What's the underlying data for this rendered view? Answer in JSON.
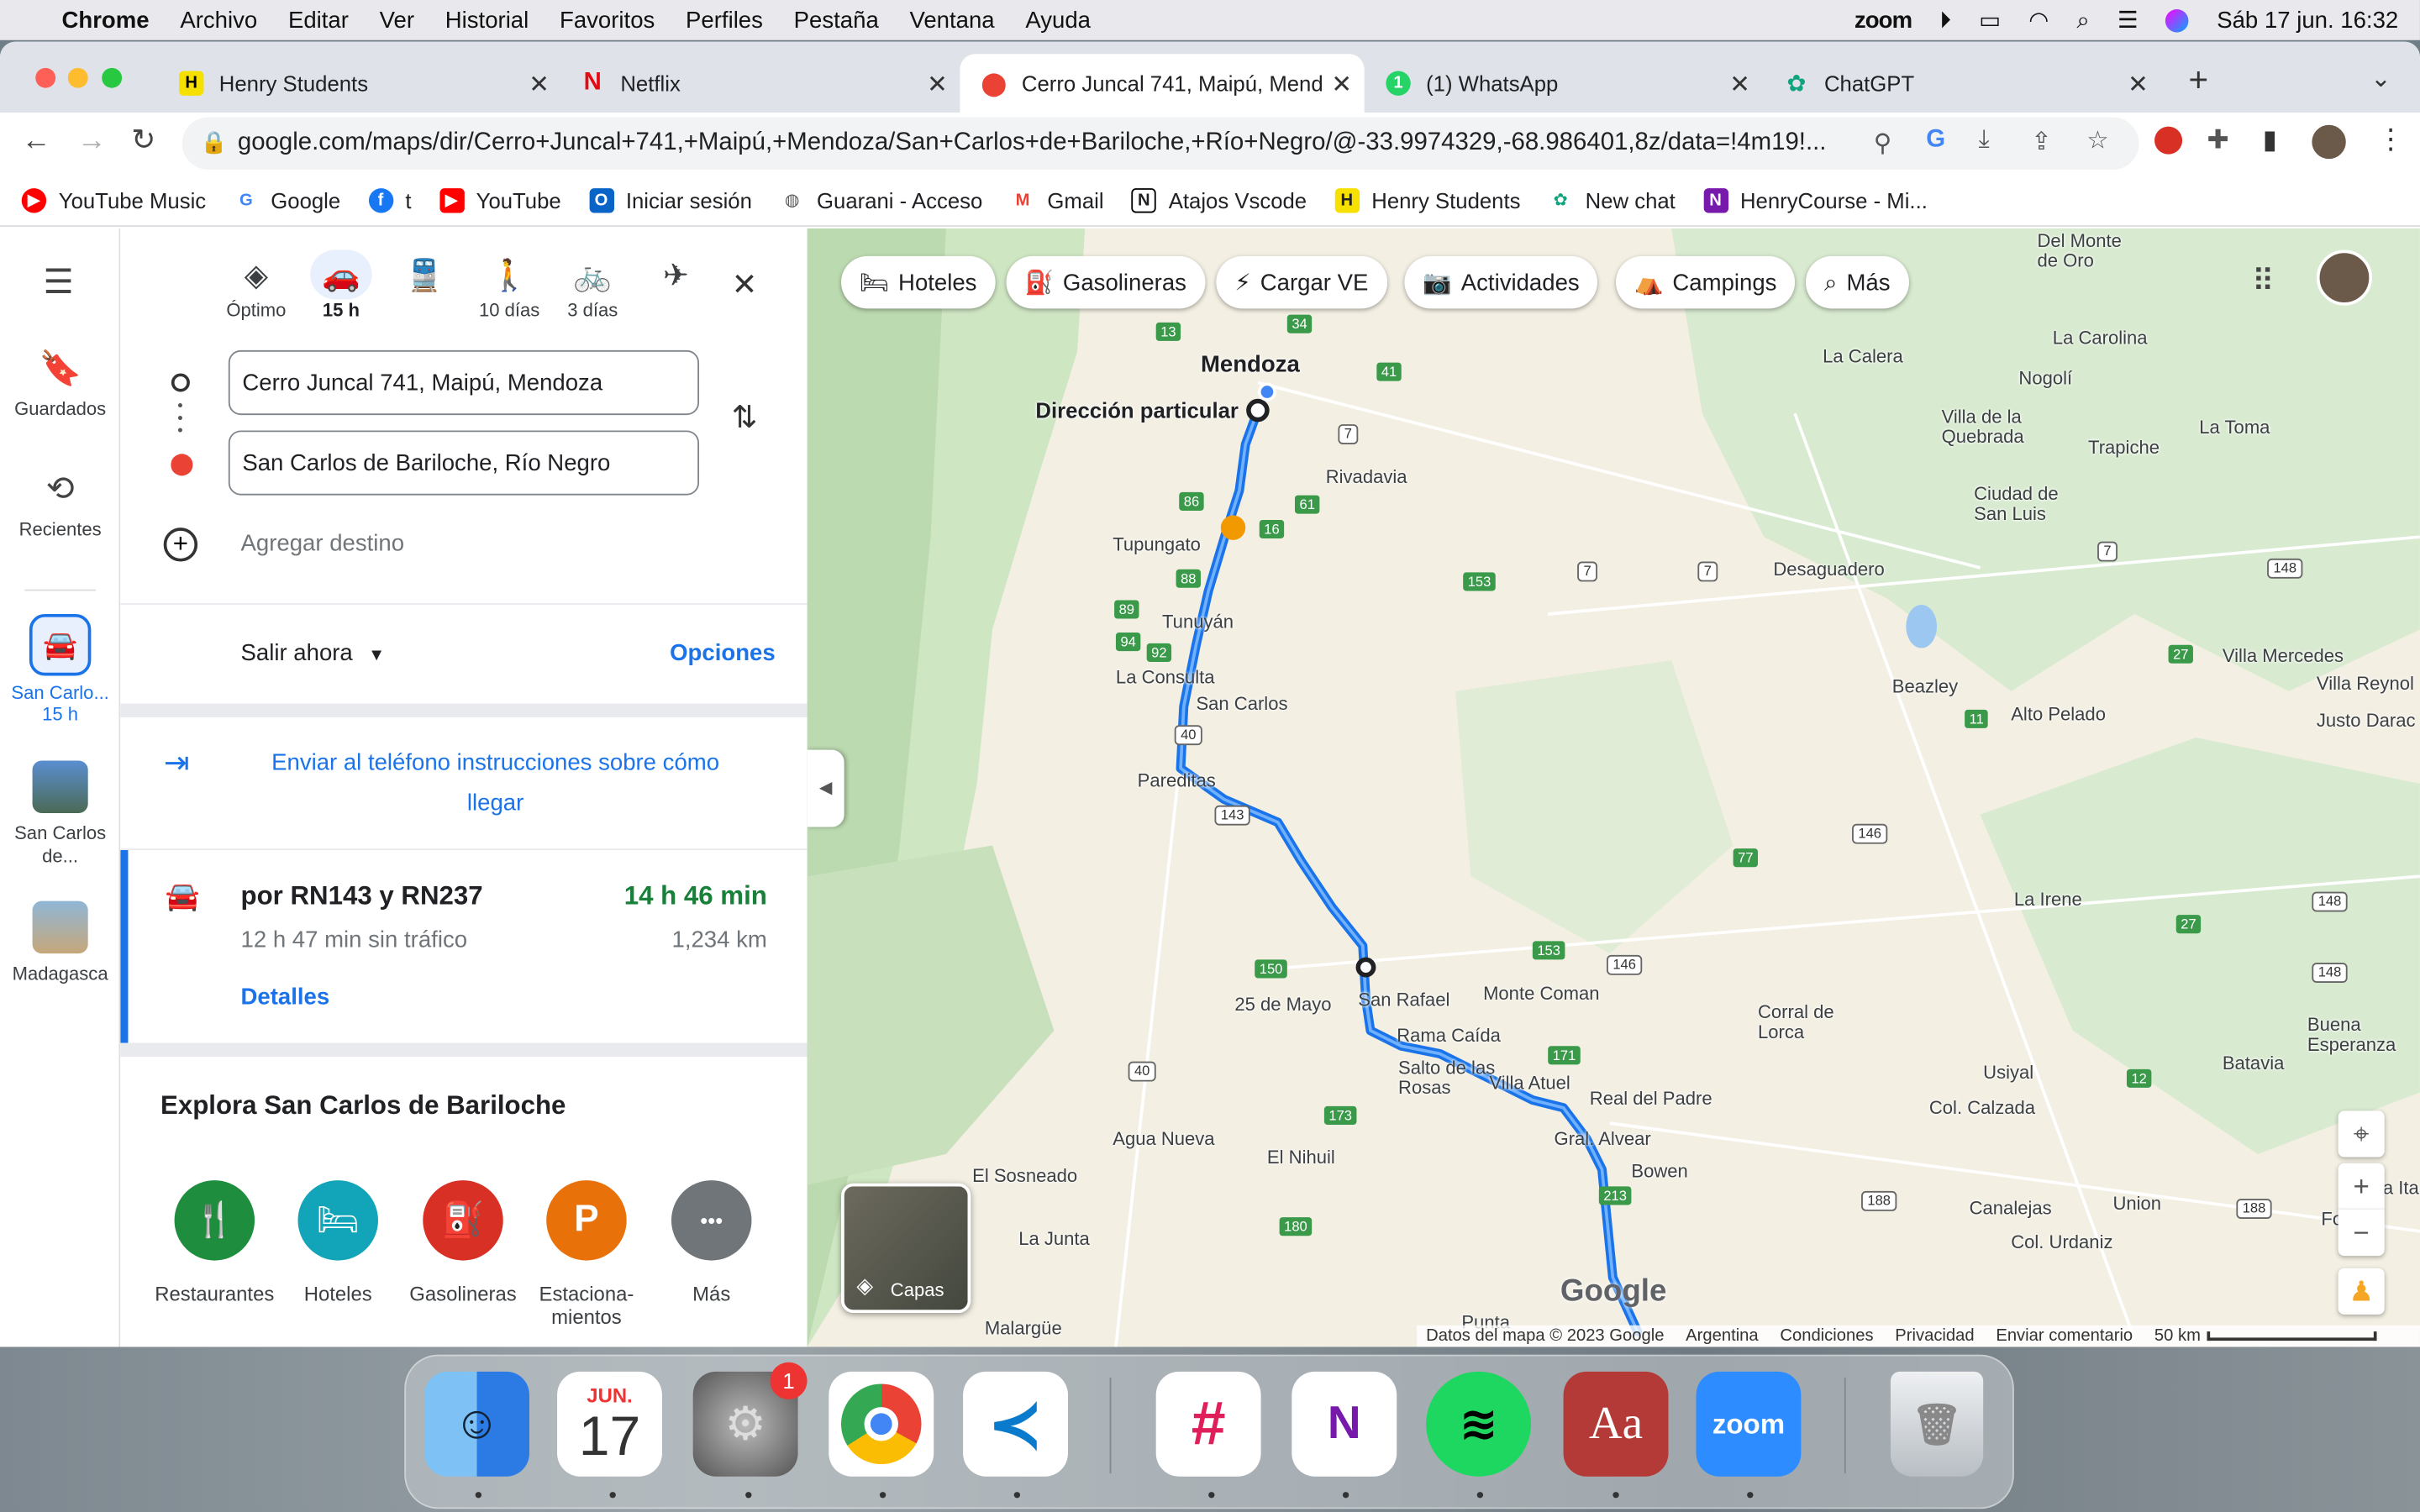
{
  "menubar": {
    "app": "Chrome",
    "items": [
      "Archivo",
      "Editar",
      "Ver",
      "Historial",
      "Favoritos",
      "Perfiles",
      "Pestaña",
      "Ventana",
      "Ayuda"
    ],
    "zoom_label": "zoom",
    "datetime": "Sáb 17 jun.  16:32"
  },
  "tabs": [
    {
      "title": "Henry Students",
      "color": "#f5e000"
    },
    {
      "title": "Netflix",
      "color": "#e50914"
    },
    {
      "title": "Cerro Juncal 741, Maipú, Mend",
      "color": "#34a853"
    },
    {
      "title": "(1) WhatsApp",
      "color": "#25d366"
    },
    {
      "title": "ChatGPT",
      "color": "#10a37f"
    }
  ],
  "url": "google.com/maps/dir/Cerro+Juncal+741,+Maipú,+Mendoza/San+Carlos+de+Bariloche,+Río+Negro/@-33.9974329,-68.986401,8z/data=!4m19!...",
  "bookmarks": [
    "YouTube Music",
    "Google",
    "t",
    "YouTube",
    "Iniciar sesión",
    "Guarani - Acceso",
    "Gmail",
    "Atajos Vscode",
    "Henry Students",
    "New chat",
    "HenryCourse - Mi..."
  ],
  "rail": {
    "saved": "Guardados",
    "recent": "Recientes",
    "item1_label": "San Carlo...",
    "item1_sub": "15 h",
    "item2_label": "San Carlos de...",
    "item3_label": "Madagasca"
  },
  "modes": [
    {
      "name": "Óptimo",
      "glyph": "◈"
    },
    {
      "name": "15 h",
      "glyph": "🚗"
    },
    {
      "name": "",
      "glyph": "🚆"
    },
    {
      "name": "10 días",
      "glyph": "🚶"
    },
    {
      "name": "3 días",
      "glyph": "🚲"
    },
    {
      "name": "",
      "glyph": "✈"
    }
  ],
  "origin": "Cerro Juncal 741, Maipú, Mendoza",
  "destination": "San Carlos de Bariloche, Río Negro",
  "add_destination": "Agregar destino",
  "depart": "Salir ahora",
  "options": "Opciones",
  "send_phone": "Enviar al teléfono instrucciones sobre cómo llegar",
  "route": {
    "via": "por RN143 y RN237",
    "duration": "14 h 46 min",
    "no_traffic": "12 h 47 min sin tráfico",
    "distance": "1,234 km",
    "details": "Detalles"
  },
  "explore": {
    "title": "Explora San Carlos de Bariloche",
    "items": [
      {
        "label": "Restaurantes",
        "color": "#1e8e3e",
        "glyph": "🍴"
      },
      {
        "label": "Hoteles",
        "color": "#12a4b8",
        "glyph": "🛏"
      },
      {
        "label": "Gasolineras",
        "color": "#d93025",
        "glyph": "⛽"
      },
      {
        "label": "Estaciona-mientos",
        "color": "#e8710a",
        "glyph": "P"
      },
      {
        "label": "Más",
        "color": "#70757a",
        "glyph": "•••"
      }
    ]
  },
  "chips": [
    "Hoteles",
    "Gasolineras",
    "Cargar VE",
    "Actividades",
    "Campings",
    "Más"
  ],
  "map": {
    "layers": "Capas",
    "brand": "Google",
    "footer": [
      "Datos del mapa © 2023 Google",
      "Argentina",
      "Condiciones",
      "Privacidad",
      "Enviar comentario",
      "50 km"
    ],
    "places": [
      {
        "name": "Mendoza",
        "big": true
      },
      {
        "name": "Dirección particular",
        "big": true
      },
      {
        "name": "Rivadavia"
      },
      {
        "name": "Tupungato"
      },
      {
        "name": "Tunuyán"
      },
      {
        "name": "La Consulta"
      },
      {
        "name": "San Carlos"
      },
      {
        "name": "Pareditas"
      },
      {
        "name": "San Rafael"
      },
      {
        "name": "25 de Mayo"
      },
      {
        "name": "Rama Caída"
      },
      {
        "name": "Salto de las Rosas"
      },
      {
        "name": "Villa Atuel"
      },
      {
        "name": "Real del Padre"
      },
      {
        "name": "Gral. Alvear"
      },
      {
        "name": "Bowen"
      },
      {
        "name": "Monte Coman"
      },
      {
        "name": "Agua Nueva"
      },
      {
        "name": "El Nihuil"
      },
      {
        "name": "El Sosneado"
      },
      {
        "name": "La Junta"
      },
      {
        "name": "Malargüe"
      },
      {
        "name": "Punta"
      },
      {
        "name": "Desaguadero"
      },
      {
        "name": "Beazley"
      },
      {
        "name": "Alto Pelado"
      },
      {
        "name": "La Irene"
      },
      {
        "name": "Corral de Lorca"
      },
      {
        "name": "Usiyal"
      },
      {
        "name": "Col. Calzada"
      },
      {
        "name": "Canalejas"
      },
      {
        "name": "Union"
      },
      {
        "name": "Col. Urdaniz"
      },
      {
        "name": "Batavia"
      },
      {
        "name": "Buena Esperanza"
      },
      {
        "name": "Villa Mercedes"
      },
      {
        "name": "Villa Reynol"
      },
      {
        "name": "Justo Darac"
      },
      {
        "name": "Ciudad de San Luis"
      },
      {
        "name": "Trapiche"
      },
      {
        "name": "La Toma"
      },
      {
        "name": "Villa de la Quebrada"
      },
      {
        "name": "Nogolí"
      },
      {
        "name": "La Calera"
      },
      {
        "name": "La Carolina"
      },
      {
        "name": "Del Monte de Oro"
      },
      {
        "name": "Fortun"
      },
      {
        "name": "Nueva Ita"
      }
    ]
  },
  "dock": [
    {
      "name": "Finder",
      "color": "#3d8de6"
    },
    {
      "name": "Calendar",
      "color": "#ffffff",
      "text": "17",
      "sub": "JUN."
    },
    {
      "name": "System Settings",
      "color": "#8e8e93",
      "badge": "1"
    },
    {
      "name": "Chrome",
      "color": "#ffffff"
    },
    {
      "name": "VS Code",
      "color": "#ffffff"
    },
    {
      "name": "Slack",
      "color": "#ffffff"
    },
    {
      "name": "OneNote",
      "color": "#ffffff",
      "text": "N"
    },
    {
      "name": "Spotify",
      "color": "#1ed760"
    },
    {
      "name": "Dictionary",
      "color": "#b33a36",
      "text": "Aa"
    },
    {
      "name": "Zoom",
      "color": "#2d8cff",
      "text": "zoom"
    },
    {
      "name": "Trash",
      "color": "#d9dde0"
    }
  ]
}
